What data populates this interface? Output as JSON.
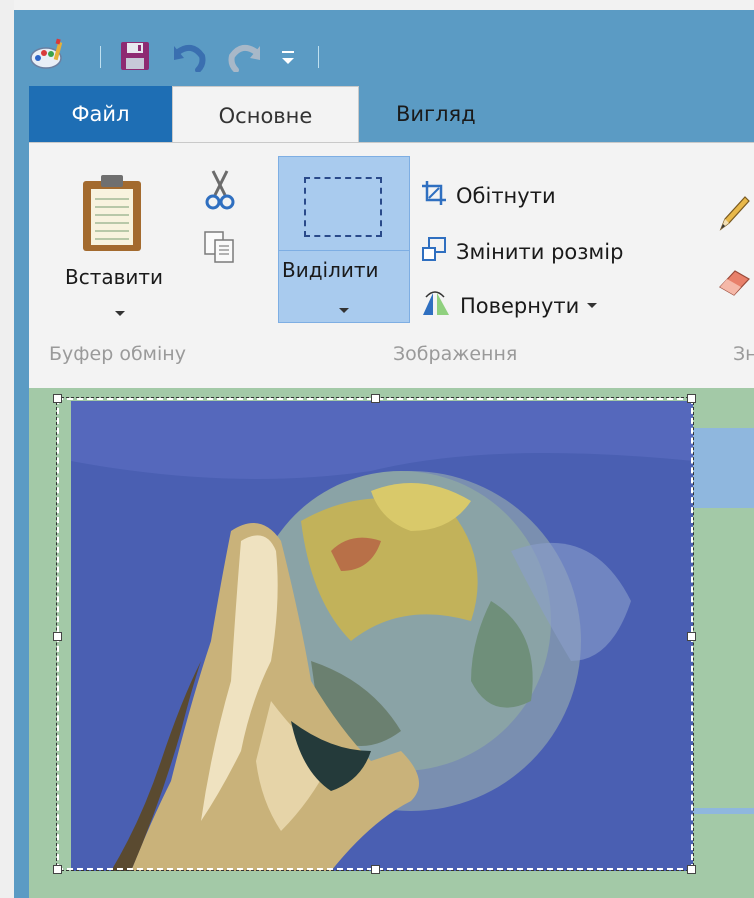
{
  "qat": {
    "icons": [
      "paint-app-icon",
      "save-icon",
      "undo-icon",
      "redo-icon",
      "customize-qat-icon"
    ]
  },
  "tabs": [
    {
      "label": "Файл"
    },
    {
      "label": "Основне"
    },
    {
      "label": "Вигляд"
    }
  ],
  "clipboard": {
    "paste_label": "Вставити",
    "group_label": "Буфер обміну",
    "cut_icon": "scissors-icon",
    "copy_icon": "copy-icon"
  },
  "image_group": {
    "select_label": "Виділити",
    "crop_label": "Обітнути",
    "resize_label": "Змінити розмір",
    "rotate_label": "Повернути",
    "group_label": "Зображення"
  },
  "tools": {
    "group_label_partial": "Зна",
    "pencil_icon": "pencil-icon",
    "eraser_icon": "eraser-icon"
  },
  "canvas": {
    "picture": "hand-holding-globe"
  },
  "colors": {
    "title_bar": "#5b9bc4",
    "file_tab": "#1e6eb4",
    "ribbon_bg": "#f3f3f3",
    "select_highlight": "#a9cbee",
    "canvas_bg": "#a3c9a7"
  }
}
